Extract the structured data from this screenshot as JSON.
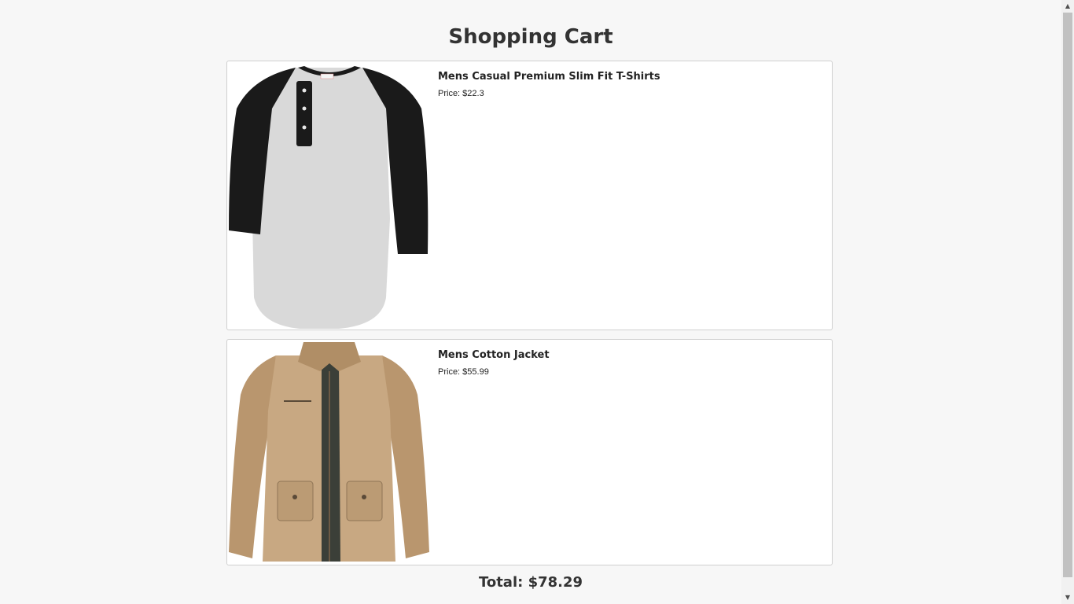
{
  "page": {
    "title": "Shopping Cart"
  },
  "cart": {
    "items": [
      {
        "name": "Mens Casual Premium Slim Fit T-Shirts",
        "price_text": "Price: $22.3",
        "image_icon": "raglan-henley-tshirt-image"
      },
      {
        "name": "Mens Cotton Jacket",
        "price_text": "Price: $55.99",
        "image_icon": "khaki-cotton-jacket-image"
      }
    ],
    "total_text": "Total: $78.29"
  },
  "colors": {
    "background": "#f7f7f7",
    "card_background": "#ffffff",
    "card_border": "#cfcfcf",
    "heading_text": "#333333",
    "shirt_body": "#d9d9d9",
    "shirt_sleeves": "#1a1a1a",
    "jacket": "#c8a882",
    "jacket_lining": "#3b3f38"
  }
}
